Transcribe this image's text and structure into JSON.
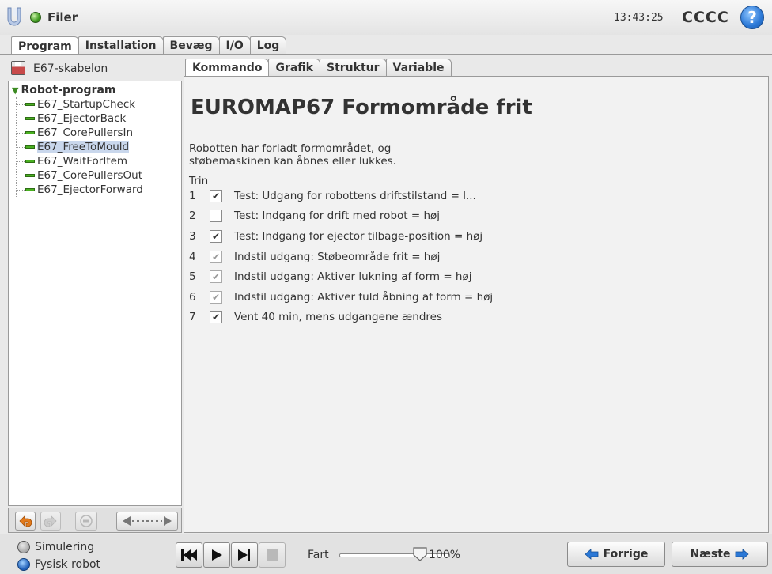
{
  "header": {
    "app_title": "Filer",
    "clock": "13:43:25",
    "robot_name": "CCCC",
    "help_label": "?"
  },
  "main_tabs": [
    {
      "label": "Program",
      "active": true
    },
    {
      "label": "Installation",
      "active": false
    },
    {
      "label": "Bevæg",
      "active": false
    },
    {
      "label": "I/O",
      "active": false
    },
    {
      "label": "Log",
      "active": false
    }
  ],
  "left": {
    "program_name": "E67-skabelon",
    "root_label": "Robot-program",
    "items": [
      {
        "label": "E67_StartupCheck",
        "selected": false
      },
      {
        "label": "E67_EjectorBack",
        "selected": false
      },
      {
        "label": "E67_CorePullersIn",
        "selected": false
      },
      {
        "label": "E67_FreeToMould",
        "selected": true
      },
      {
        "label": "E67_WaitForItem",
        "selected": false
      },
      {
        "label": "E67_CorePullersOut",
        "selected": false
      },
      {
        "label": "E67_EjectorForward",
        "selected": false
      }
    ]
  },
  "sub_tabs": [
    {
      "label": "Kommando",
      "active": true
    },
    {
      "label": "Grafik",
      "active": false
    },
    {
      "label": "Struktur",
      "active": false
    },
    {
      "label": "Variable",
      "active": false
    }
  ],
  "command": {
    "title": "EUROMAP67 Formområde frit",
    "description_line1": "Robotten har forladt formområdet, og",
    "description_line2": "støbemaskinen kan åbnes eller lukkes.",
    "steps_label": "Trin",
    "steps": [
      {
        "num": "1",
        "text": "Test: Udgang for robottens driftstilstand = l...",
        "checked": true,
        "dim": false
      },
      {
        "num": "2",
        "text": "Test: Indgang for drift med robot = høj",
        "checked": false,
        "dim": false
      },
      {
        "num": "3",
        "text": "Test: Indgang for ejector tilbage-position = høj",
        "checked": true,
        "dim": false
      },
      {
        "num": "4",
        "text": "Indstil udgang: Støbeområde frit = høj",
        "checked": true,
        "dim": true
      },
      {
        "num": "5",
        "text": "Indstil udgang: Aktiver lukning af form = høj",
        "checked": true,
        "dim": true
      },
      {
        "num": "6",
        "text": "Indstil udgang: Aktiver fuld åbning af form = høj",
        "checked": true,
        "dim": true
      },
      {
        "num": "7",
        "text": "Vent 40 min, mens udgangene ændres",
        "checked": true,
        "dim": false
      }
    ]
  },
  "bottom": {
    "mode_simulation": "Simulering",
    "mode_physical": "Fysisk robot",
    "speed_label": "Fart",
    "speed_value": "100%",
    "speed_fraction": 1.0,
    "prev_label": "Forrige",
    "next_label": "Næste"
  },
  "colors": {
    "accent_blue": "#2b78d6",
    "ok_green": "#49b020",
    "selection": "#c9d7ec"
  }
}
